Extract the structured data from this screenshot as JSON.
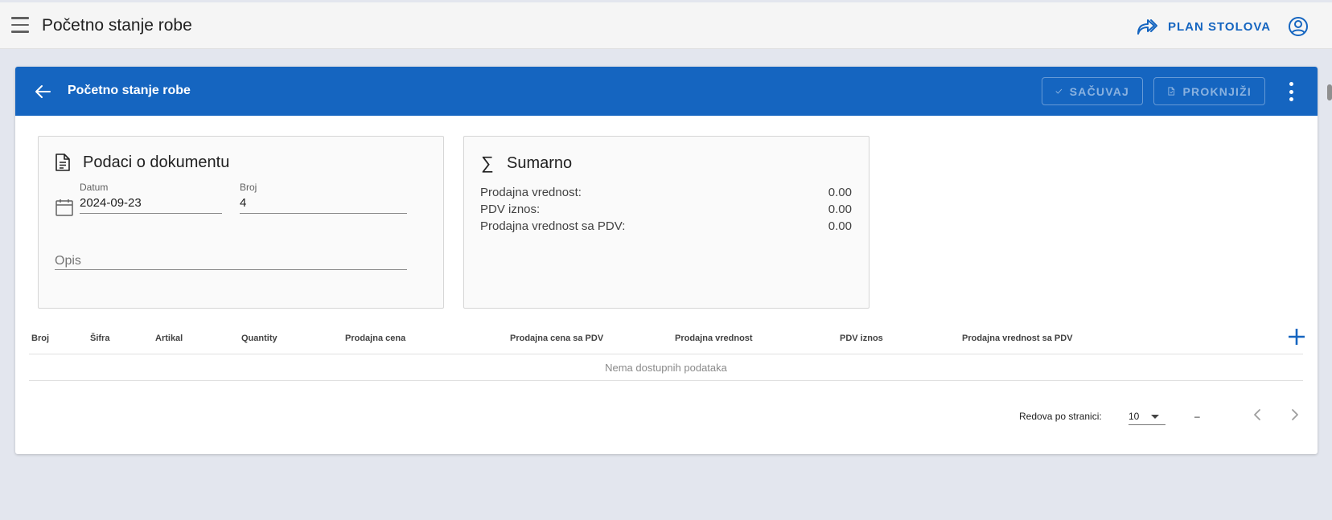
{
  "appbar": {
    "title": "Početno stanje robe",
    "plan_label": "PLAN STOLOVA"
  },
  "toolbar": {
    "title": "Početno stanje robe",
    "save_label": "SAČUVAJ",
    "post_label": "PROKNJIŽI"
  },
  "document": {
    "heading": "Podaci o dokumentu",
    "date_label": "Datum",
    "date_value": "2024-09-23",
    "number_label": "Broj",
    "number_value": "4",
    "description_label": "Opis"
  },
  "summary": {
    "heading": "Sumarno",
    "rows": [
      {
        "label": "Prodajna vrednost:",
        "value": "0.00"
      },
      {
        "label": "PDV iznos:",
        "value": "0.00"
      },
      {
        "label": "Prodajna vrednost sa PDV:",
        "value": "0.00"
      }
    ]
  },
  "table": {
    "columns": [
      "Broj",
      "Šifra",
      "Artikal",
      "Quantity",
      "Prodajna cena",
      "Prodajna cena sa PDV",
      "Prodajna vrednost",
      "PDV iznos",
      "Prodajna vrednost sa PDV"
    ],
    "empty_text": "Nema dostupnih podataka"
  },
  "pagination": {
    "rows_label": "Redova po stranici:",
    "rows_value": "10",
    "range": "–"
  },
  "colors": {
    "primary": "#1565c0",
    "background": "#e3e6ee"
  }
}
